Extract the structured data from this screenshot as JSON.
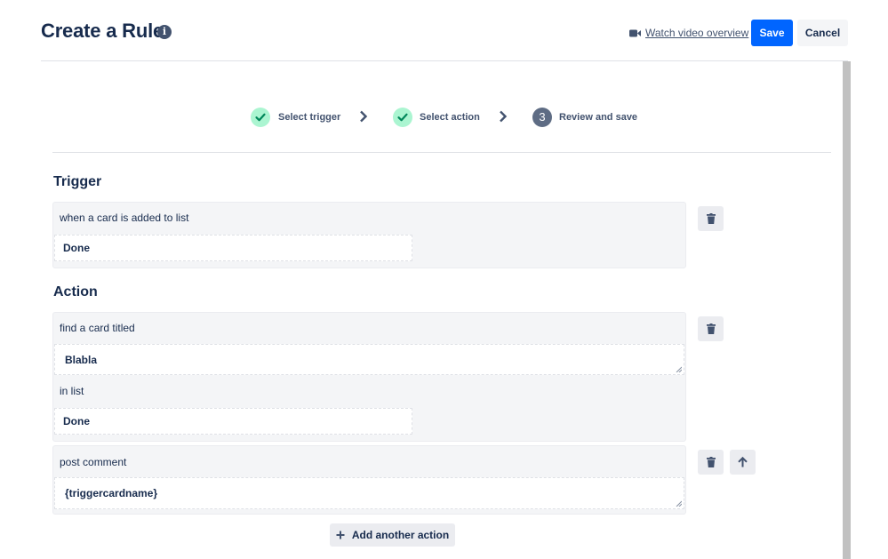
{
  "header": {
    "title": "Create a Rule",
    "info_icon": "i",
    "video_link": "Watch video overview",
    "save_label": "Save",
    "cancel_label": "Cancel"
  },
  "stepper": {
    "steps": [
      {
        "label": "Select trigger",
        "state": "complete"
      },
      {
        "label": "Select action",
        "state": "complete"
      },
      {
        "label": "Review and save",
        "state": "current",
        "number": "3"
      }
    ]
  },
  "trigger": {
    "section_title": "Trigger",
    "text": "when a card is added to list",
    "list_value": "Done"
  },
  "action": {
    "section_title": "Action",
    "actions": [
      {
        "text": "find a card titled",
        "title_value": "Blabla",
        "list_text": "in list",
        "list_value": "Done"
      },
      {
        "text": "post comment",
        "comment_value": "{triggercardname}"
      }
    ],
    "add_label": "Add another action"
  },
  "colors": {
    "primary": "#0065ff",
    "check_bg": "#abf5d1",
    "check": "#00875a",
    "step_current": "#5e6c84",
    "card_bg": "#f4f5f7"
  }
}
